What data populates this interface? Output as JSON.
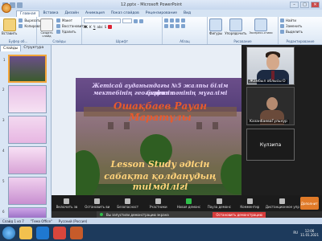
{
  "window": {
    "title": "12.pptx - Microsoft PowerPoint",
    "controls": [
      "–",
      "□",
      "✕"
    ]
  },
  "ribbon": {
    "tabs": [
      "Главная",
      "Вставка",
      "Дизайн",
      "Анимация",
      "Показ слайдов",
      "Рецензирование",
      "Вид"
    ],
    "groups": {
      "clipboard": {
        "paste": "Вставить",
        "cut": "Вырезать",
        "copy": "Копировать",
        "format": "Формат",
        "label": "Буфер об..."
      },
      "slides": {
        "create": "Создать слайд",
        "layout": "Макет",
        "reset": "Восстановить",
        "delete": "Удалить",
        "label": "Слайды"
      },
      "font": {
        "label": "Шрифт"
      },
      "paragraph": {
        "label": "Абзац"
      },
      "drawing": {
        "shapes": "Фигуры",
        "arrange": "Упорядочить",
        "styles": "Экспресс-стили",
        "label": "Рисование"
      },
      "editing": {
        "find": "Найти",
        "replace": "Заменить",
        "select": "Выделить",
        "label": "Редактирование"
      }
    }
  },
  "left_pane": {
    "tabs": [
      "Слайды",
      "Структура"
    ],
    "slide_numbers": [
      "1",
      "2",
      "3",
      "4",
      "5",
      "6"
    ]
  },
  "slide": {
    "line1": "Жетісай ауданындағы №5 жалпы білім беретін",
    "line2": "мектебінің география пәнінің мұғалімі",
    "name": "Ошақбаев Рауан Маратұлы",
    "ls1": "Lesson Study әдісін",
    "ls2": "сабақта қолданудың тиімділігі"
  },
  "participants": [
    {
      "name": "Жамбыл облысы О"
    },
    {
      "name": "KазанбаеваГульнур"
    },
    {
      "name": "Күлзипа"
    }
  ],
  "zoom_bar": {
    "buttons": [
      "Включить зв",
      "Остановить ви",
      "Безопасност",
      "Участники",
      "Новая демонс",
      "Пауза демонс",
      "Комментир",
      "Дистанционное упр",
      "Дополнит"
    ],
    "participants_count": "36",
    "end_label": "Завер"
  },
  "share_bar": {
    "text": "Вы запустили демонстрацию экрана",
    "stop": "Остановить демонстрацию"
  },
  "statusbar": {
    "slide": "Слайд 1 из 7",
    "theme": "\"Тема Office\"",
    "lang": "Русский (Россия)"
  },
  "taskbar": {
    "lang": "RU",
    "time": "12:06",
    "date": "11.01.2021"
  }
}
